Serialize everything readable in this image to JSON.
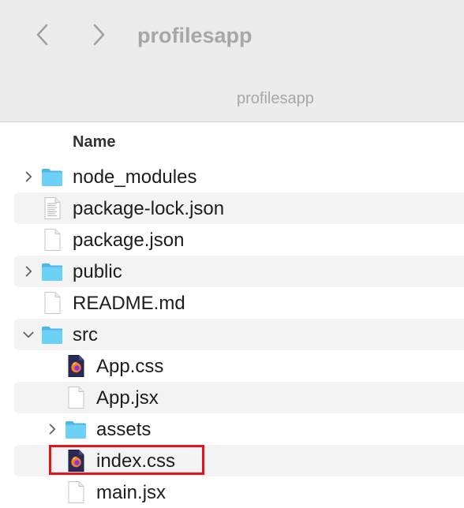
{
  "toolbar": {
    "back_label": "Back",
    "forward_label": "Forward",
    "title": "profilesapp",
    "path_tab": "profilesapp"
  },
  "columns": {
    "name": "Name"
  },
  "items": [
    {
      "name": "node_modules",
      "kind": "folder",
      "expanded": false,
      "has_disclosure": true,
      "depth": 0,
      "icon": "folder-icon"
    },
    {
      "name": "package-lock.json",
      "kind": "document",
      "has_disclosure": false,
      "depth": 0,
      "icon": "text-document-icon"
    },
    {
      "name": "package.json",
      "kind": "document",
      "has_disclosure": false,
      "depth": 0,
      "icon": "document-icon"
    },
    {
      "name": "public",
      "kind": "folder",
      "expanded": false,
      "has_disclosure": true,
      "depth": 0,
      "icon": "folder-icon"
    },
    {
      "name": "README.md",
      "kind": "document",
      "has_disclosure": false,
      "depth": 0,
      "icon": "document-icon"
    },
    {
      "name": "src",
      "kind": "folder",
      "expanded": true,
      "has_disclosure": true,
      "depth": 0,
      "icon": "folder-icon"
    },
    {
      "name": "App.css",
      "kind": "css",
      "has_disclosure": false,
      "depth": 1,
      "icon": "firefox-css-icon"
    },
    {
      "name": "App.jsx",
      "kind": "document",
      "has_disclosure": false,
      "depth": 1,
      "icon": "document-icon"
    },
    {
      "name": "assets",
      "kind": "folder",
      "expanded": false,
      "has_disclosure": true,
      "depth": 1,
      "icon": "folder-icon"
    },
    {
      "name": "index.css",
      "kind": "css",
      "has_disclosure": false,
      "depth": 1,
      "icon": "firefox-css-icon",
      "highlighted": true
    },
    {
      "name": "main.jsx",
      "kind": "document",
      "has_disclosure": false,
      "depth": 1,
      "icon": "document-icon"
    }
  ],
  "colors": {
    "folder": "#5ec8f2",
    "highlight_border": "#e3141c",
    "toolbar_bg": "#ececec",
    "alt_row": "#f3f3f3"
  }
}
